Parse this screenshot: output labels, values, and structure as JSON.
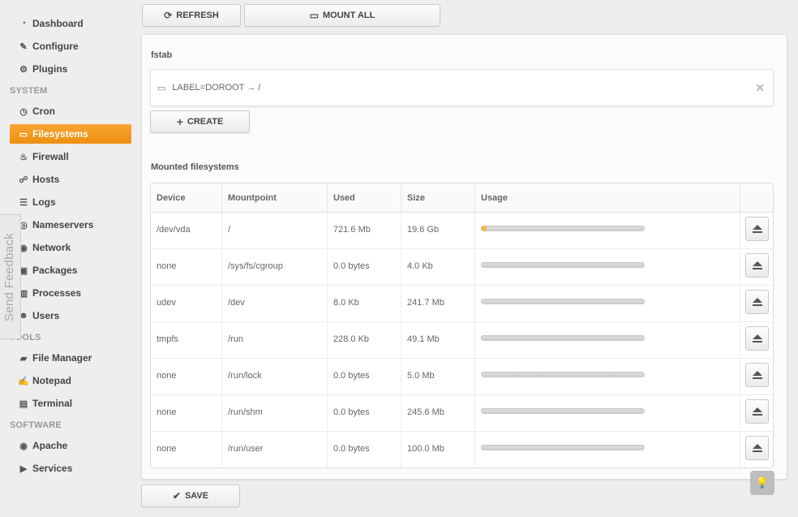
{
  "sidebar": {
    "items": [
      {
        "label": "Dashboard",
        "icon": "dashboard-icon",
        "glyph": "◔"
      },
      {
        "label": "Configure",
        "icon": "wrench-icon",
        "glyph": "✎"
      },
      {
        "label": "Plugins",
        "icon": "cogs-icon",
        "glyph": "⚙"
      },
      {
        "label": "Cron",
        "icon": "clock-icon",
        "glyph": "◷"
      },
      {
        "label": "Filesystems",
        "icon": "hdd-icon",
        "glyph": "▭",
        "active": true
      },
      {
        "label": "Firewall",
        "icon": "fire-icon",
        "glyph": "♨"
      },
      {
        "label": "Hosts",
        "icon": "sitemap-icon",
        "glyph": "☍"
      },
      {
        "label": "Logs",
        "icon": "list-icon",
        "glyph": "☰"
      },
      {
        "label": "Nameservers",
        "icon": "bullseye-icon",
        "glyph": "◎"
      },
      {
        "label": "Network",
        "icon": "globe-icon",
        "glyph": "◉"
      },
      {
        "label": "Packages",
        "icon": "gift-icon",
        "glyph": "▣"
      },
      {
        "label": "Processes",
        "icon": "columns-icon",
        "glyph": "▥"
      },
      {
        "label": "Users",
        "icon": "group-icon",
        "glyph": "☻"
      },
      {
        "label": "File Manager",
        "icon": "folder-open-icon",
        "glyph": "▰"
      },
      {
        "label": "Notepad",
        "icon": "edit-icon",
        "glyph": "✍"
      },
      {
        "label": "Terminal",
        "icon": "terminal-icon",
        "glyph": "▤"
      },
      {
        "label": "Apache",
        "icon": "globe-icon",
        "glyph": "◉"
      },
      {
        "label": "Services",
        "icon": "play-icon",
        "glyph": "▶"
      }
    ],
    "sections": {
      "system": "SYSTEM",
      "tools": "TOOLS",
      "software": "SOFTWARE"
    }
  },
  "feedback": {
    "label": "Send Feedback"
  },
  "toolbar": {
    "refresh_label": "REFRESH",
    "mount_all_label": "MOUNT ALL"
  },
  "fstab": {
    "title": "fstab",
    "entry": "LABEL=DOROOT → /",
    "create_label": "CREATE"
  },
  "mounted": {
    "title": "Mounted filesystems",
    "columns": [
      "Device",
      "Mountpoint",
      "Used",
      "Size",
      "Usage"
    ],
    "rows": [
      {
        "device": "/dev/vda",
        "mountpoint": "/",
        "used": "721.6 Mb",
        "size": "19.6 Gb",
        "usage": 0.036
      },
      {
        "device": "none",
        "mountpoint": "/sys/fs/cgroup",
        "used": "0.0 bytes",
        "size": "4.0 Kb",
        "usage": 0
      },
      {
        "device": "udev",
        "mountpoint": "/dev",
        "used": "8.0 Kb",
        "size": "241.7 Mb",
        "usage": 0
      },
      {
        "device": "tmpfs",
        "mountpoint": "/run",
        "used": "228.0 Kb",
        "size": "49.1 Mb",
        "usage": 0.005
      },
      {
        "device": "none",
        "mountpoint": "/run/lock",
        "used": "0.0 bytes",
        "size": "5.0 Mb",
        "usage": 0
      },
      {
        "device": "none",
        "mountpoint": "/run/shm",
        "used": "0.0 bytes",
        "size": "245.6 Mb",
        "usage": 0
      },
      {
        "device": "none",
        "mountpoint": "/run/user",
        "used": "0.0 bytes",
        "size": "100.0 Mb",
        "usage": 0
      }
    ]
  },
  "footer": {
    "save_label": "SAVE"
  },
  "colors": {
    "accent": "#f39c12",
    "usage_fill": "#f0b84d"
  }
}
